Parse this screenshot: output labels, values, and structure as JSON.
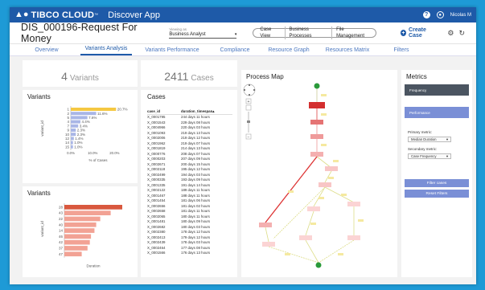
{
  "app": {
    "logo": "▲●",
    "brand": "TIBCO CLOUD",
    "trademark": "™",
    "name": "Discover App"
  },
  "user": {
    "name": "Nicolas M",
    "help": "?"
  },
  "header": {
    "title": "DIS_000196-Request For Money",
    "viewing_label": "Viewing as",
    "viewing_value": "Business Analyst",
    "view_buttons": [
      "Case View",
      "Business Processes",
      "File Management"
    ],
    "create_label": "Create Case"
  },
  "tabs": [
    {
      "label": "Overview",
      "active": false
    },
    {
      "label": "Variants Analysis",
      "active": true
    },
    {
      "label": "Variants Performance",
      "active": false
    },
    {
      "label": "Compliance",
      "active": false
    },
    {
      "label": "Resource Graph",
      "active": false
    },
    {
      "label": "Resources Matrix",
      "active": false
    },
    {
      "label": "Filters",
      "active": false
    }
  ],
  "stats": {
    "variants_count": "4",
    "variants_label": "Variants",
    "cases_count": "2411",
    "cases_label": "Cases"
  },
  "variants_pct_chart": {
    "title": "Variants",
    "ylabel": "variant_id",
    "xlabel": "% of Cases",
    "categories": [
      "1",
      "2",
      "5",
      "4",
      "7",
      "9",
      "10",
      "12",
      "14",
      "15"
    ],
    "values": [
      20.7,
      11.6,
      7.6,
      4.4,
      3.4,
      2.3,
      2.3,
      1.4,
      1.0,
      1.0
    ],
    "value_labels": [
      "20.7%",
      "11.6%",
      "7.6%",
      "4.4%",
      "3.4%",
      "2.3%",
      "2.3%",
      "1.4%",
      "1.0%",
      "1.0%"
    ],
    "ticks": [
      "0.0%",
      "10.0%",
      "20.0%"
    ],
    "xlim": [
      0,
      25
    ],
    "color_top": "#f5c842",
    "color_rest": "#a9b6e6"
  },
  "variants_dur_chart": {
    "title": "Variants",
    "ylabel": "variant_id",
    "xlabel": "Duration",
    "categories": [
      "28",
      "43",
      "22",
      "40",
      "14",
      "46",
      "42",
      "37",
      "47"
    ],
    "values": [
      100,
      80,
      62,
      55,
      52,
      46,
      44,
      40,
      30
    ],
    "color_top": "#d9583e",
    "color_rest": "#f2a294"
  },
  "cases": {
    "title": "Cases",
    "headers": [
      "case_id",
      "duration_timespan"
    ],
    "sort_icon": "▴",
    "rows": [
      [
        "X_0001795",
        "244 days 11 hours"
      ],
      [
        "X_0001543",
        "229 days 08 hours"
      ],
      [
        "X_0004966",
        "220 days 03 hours"
      ],
      [
        "X_0001093",
        "219 days 13 hours"
      ],
      [
        "X_0002006",
        "219 days 12 hours"
      ],
      [
        "X_0001962",
        "219 days 07 hours"
      ],
      [
        "X_0001819",
        "214 days 13 hours"
      ],
      [
        "X_0000776",
        "208 days 07 hours"
      ],
      [
        "X_0000203",
        "207 days 09 hours"
      ],
      [
        "X_0002671",
        "200 days 15 hours"
      ],
      [
        "X_0002118",
        "195 days 12 hours"
      ],
      [
        "X_0002499",
        "194 days 03 hours"
      ],
      [
        "X_0000335",
        "193 days 09 hours"
      ],
      [
        "X_0001335",
        "191 days 14 hours"
      ],
      [
        "X_0002122",
        "189 days 11 hours"
      ],
      [
        "X_0001467",
        "188 days 11 hours"
      ],
      [
        "X_0001454",
        "181 days 06 hours"
      ],
      [
        "X_0002656",
        "181 days 02 hours"
      ],
      [
        "X_0002658",
        "181 days 11 hours"
      ],
      [
        "X_0002065",
        "180 days 11 hours"
      ],
      [
        "X_0001481",
        "180 days 09 hours"
      ],
      [
        "X_0002682",
        "180 days 03 hours"
      ],
      [
        "X_0002380",
        "178 days 12 hours"
      ],
      [
        "X_0002413",
        "179 days 12 hours"
      ],
      [
        "X_0002439",
        "178 days 03 hours"
      ],
      [
        "X_0002464",
        "177 days 08 hours"
      ],
      [
        "X_0001566",
        "176 days 13 hours"
      ]
    ]
  },
  "process_map": {
    "title": "Process Map"
  },
  "metrics": {
    "title": "Metrics",
    "frequency_label": "Frequency",
    "performance_label": "Performance",
    "primary_label": "Primary metric:",
    "primary_value": "Median Duration",
    "secondary_label": "Secondary metric:",
    "secondary_value": "Case Frequency",
    "filter_btn": "Filter cases",
    "reset_btn": "Reset Filters"
  },
  "colors": {
    "brand": "#1e5aa8",
    "page_bg": "#1e9ad6",
    "metric_dark": "#4b5561",
    "metric_mid": "#7a8fd6"
  }
}
